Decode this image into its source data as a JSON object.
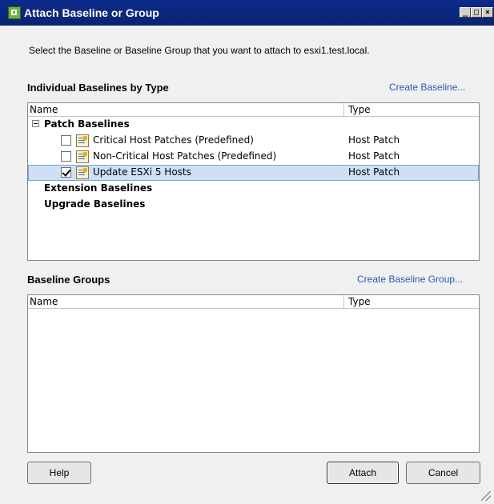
{
  "window": {
    "title": "Attach Baseline or Group",
    "min_glyph": "_",
    "max_glyph": "□",
    "close_glyph": "×"
  },
  "instruction": "Select the Baseline or Baseline Group that you want to attach to esxi1.test.local.",
  "baselines_section": {
    "title": "Individual Baselines by Type",
    "create_link": "Create Baseline...",
    "columns": [
      "Name",
      "Type"
    ],
    "groups": [
      {
        "label": "Patch Baselines",
        "expanded": true,
        "items": [
          {
            "label": "Critical Host Patches (Predefined)",
            "type": "Host Patch",
            "checked": false
          },
          {
            "label": "Non-Critical Host Patches (Predefined)",
            "type": "Host Patch",
            "checked": false
          },
          {
            "label": "Update ESXi 5 Hosts",
            "type": "Host Patch",
            "checked": true,
            "selected": true
          }
        ]
      },
      {
        "label": "Extension Baselines"
      },
      {
        "label": "Upgrade Baselines"
      }
    ]
  },
  "groups_section": {
    "title": "Baseline Groups",
    "create_link": "Create Baseline Group...",
    "columns": [
      "Name",
      "Type"
    ]
  },
  "buttons": {
    "help": "Help",
    "attach": "Attach",
    "cancel": "Cancel"
  },
  "colors": {
    "title_bar": "#0a2470",
    "link": "#2a58b8",
    "selection": "#cfe0f5"
  },
  "icons": [
    "vsphere-app-icon",
    "collapse-minus-icon",
    "baseline-document-icon",
    "resize-grip-icon"
  ]
}
